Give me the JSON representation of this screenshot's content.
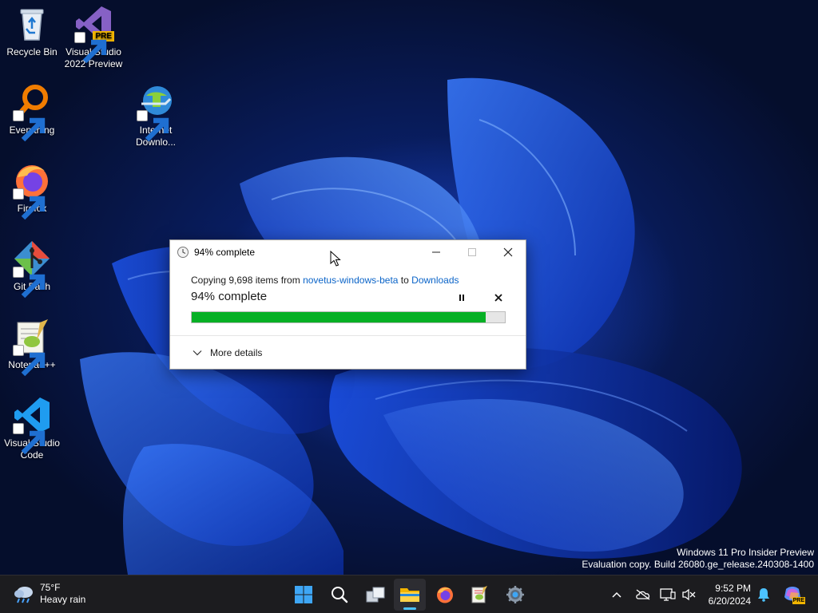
{
  "desktop": {
    "icons": [
      {
        "label": "Recycle Bin"
      },
      {
        "label": "Visual Studio 2022 Preview"
      },
      {
        "label": "Everything"
      },
      {
        "label": "Internet Downlo..."
      },
      {
        "label": "Firefox"
      },
      {
        "label": "Git Bash"
      },
      {
        "label": "Notepad++"
      },
      {
        "label": "Visual Studio Code"
      }
    ],
    "vs_badge": "PRE"
  },
  "dialog": {
    "title": "94% complete",
    "copy_prefix": "Copying 9,698 items from ",
    "source": "novetus-windows-beta",
    "copy_mid": " to ",
    "destination": "Downloads",
    "percent_text": "94% complete",
    "progress_percent": 94,
    "progress_color": "#06b025",
    "more_details": "More details"
  },
  "watermark": {
    "line1": "Windows 11 Pro Insider Preview",
    "line2": "Evaluation copy. Build 26080.ge_release.240308-1400"
  },
  "taskbar": {
    "weather_temp": "75°F",
    "weather_desc": "Heavy rain",
    "apps": [
      "start-icon",
      "search-icon",
      "task-view-icon",
      "file-explorer-icon",
      "firefox-icon",
      "notepad-plus-plus-icon",
      "settings-icon"
    ],
    "active_app": "file-explorer-icon",
    "tray": [
      "chevron-up-icon",
      "onedrive-icon",
      "network-icon",
      "volume-muted-icon",
      "notification-bell-icon",
      "copilot-icon"
    ],
    "clock_time": "9:52 PM",
    "clock_date": "6/20/2024",
    "copilot_badge": "PRE"
  }
}
